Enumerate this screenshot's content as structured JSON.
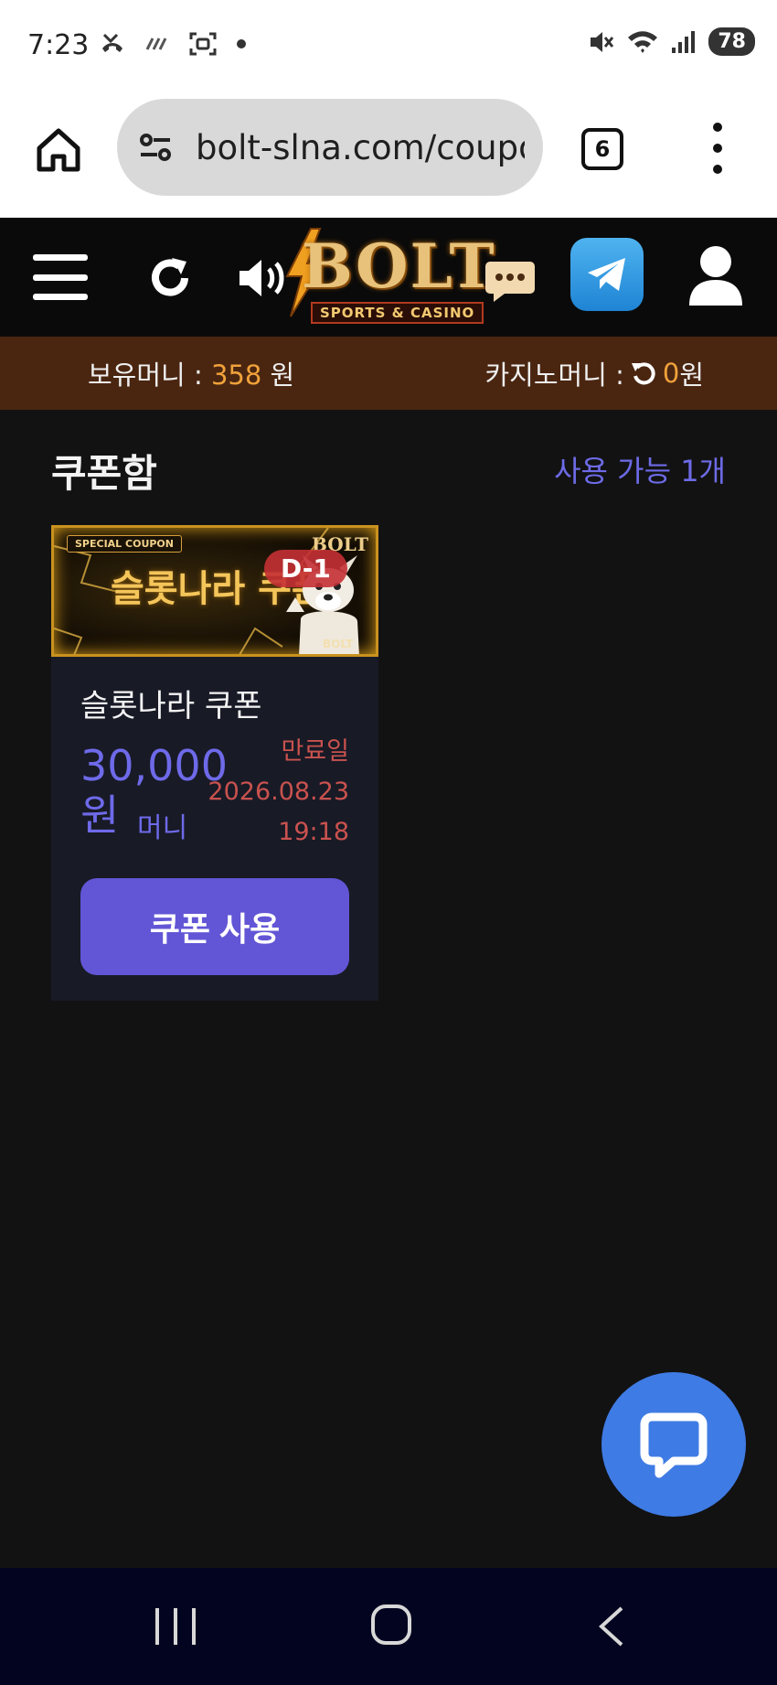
{
  "status_bar": {
    "time": "7:23",
    "battery": "78"
  },
  "browser": {
    "url": "bolt-slna.com/coupon",
    "tab_count": "6"
  },
  "header": {
    "logo_text": "BOLT",
    "logo_subtitle": "SPORTS & CASINO"
  },
  "balance": {
    "held_label": "보유머니 : ",
    "held_value": "358",
    "held_unit": " 원",
    "casino_label": "카지노머니 : ",
    "casino_value": "0",
    "casino_unit": " 원"
  },
  "coupon_box": {
    "title": "쿠폰함",
    "available": "사용 가능 1개",
    "coupons": [
      {
        "banner_tag": "SPECIAL COUPON",
        "banner_title": "슬롯나라 쿠폰",
        "banner_logo": "BOLT",
        "d_day": "D-1",
        "name": "슬롯나라 쿠폰",
        "amount": "30,000",
        "amount_unit": "원",
        "money_label": "머니",
        "expiry_label": "만료일",
        "expiry_date": "2026.08.23",
        "expiry_time": "19:18",
        "use_label": "쿠폰 사용"
      }
    ]
  },
  "colors": {
    "accent": "#6256d6",
    "gold": "#f0a23a",
    "expiry": "#c9524e",
    "chat": "#3f7be4"
  }
}
